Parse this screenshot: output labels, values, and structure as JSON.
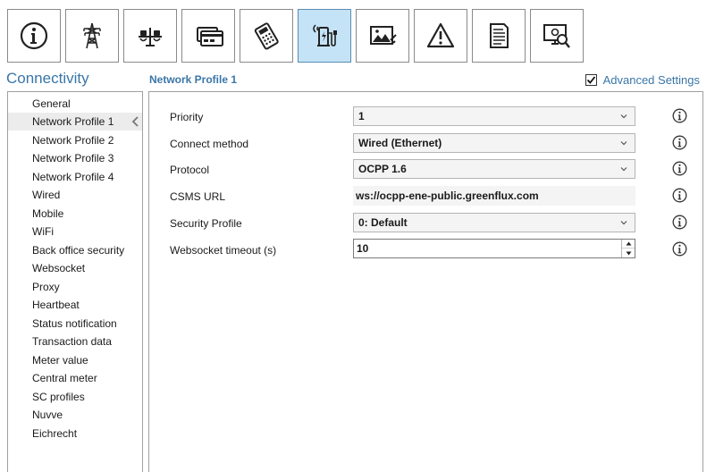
{
  "toolbar": {
    "buttons": [
      {
        "icon": "info-icon"
      },
      {
        "icon": "power-pylon-icon"
      },
      {
        "icon": "scale-balance-icon"
      },
      {
        "icon": "card-reader-icon"
      },
      {
        "icon": "payment-terminal-icon"
      },
      {
        "icon": "connectivity-charger-icon",
        "active": true
      },
      {
        "icon": "display-image-icon"
      },
      {
        "icon": "warning-icon"
      },
      {
        "icon": "document-icon"
      },
      {
        "icon": "monitor-search-icon"
      }
    ]
  },
  "section": {
    "title": "Connectivity"
  },
  "page": {
    "title": "Network Profile 1"
  },
  "advanced": {
    "label": "Advanced Settings",
    "checked": true
  },
  "sidebar": {
    "items": [
      {
        "label": "General"
      },
      {
        "label": "Network Profile 1",
        "selected": true
      },
      {
        "label": "Network Profile 2"
      },
      {
        "label": "Network Profile 3"
      },
      {
        "label": "Network Profile 4"
      },
      {
        "label": "Wired"
      },
      {
        "label": "Mobile"
      },
      {
        "label": "WiFi"
      },
      {
        "label": "Back office security"
      },
      {
        "label": "Websocket"
      },
      {
        "label": "Proxy"
      },
      {
        "label": "Heartbeat"
      },
      {
        "label": "Status notification"
      },
      {
        "label": "Transaction data"
      },
      {
        "label": "Meter value"
      },
      {
        "label": "Central meter"
      },
      {
        "label": "SC profiles"
      },
      {
        "label": "Nuvve"
      },
      {
        "label": "Eichrecht"
      }
    ]
  },
  "form": {
    "priority": {
      "label": "Priority",
      "value": "1"
    },
    "connect_method": {
      "label": "Connect method",
      "value": "Wired (Ethernet)"
    },
    "protocol": {
      "label": "Protocol",
      "value": "OCPP 1.6"
    },
    "csms_url": {
      "label": "CSMS URL",
      "value": "ws://ocpp-ene-public.greenflux.com"
    },
    "security_profile": {
      "label": "Security Profile",
      "value": "0: Default"
    },
    "websocket_timeout": {
      "label": "Websocket timeout (s)",
      "value": "10"
    }
  },
  "colors": {
    "accent": "#3a76a8",
    "active_tab": "#c5e3f6",
    "selected_row": "#ececec"
  }
}
